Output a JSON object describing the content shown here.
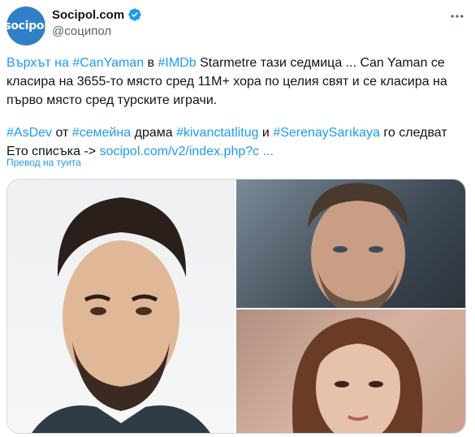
{
  "account": {
    "avatar_text": "socipol",
    "name": "Socipol.com",
    "handle": "@соципол",
    "verified": true
  },
  "tweet": {
    "line1": [
      {
        "text": "Върхът на ",
        "link": true
      },
      {
        "text": "#CanYaman",
        "link": true
      },
      {
        "text": " в ",
        "link": false
      },
      {
        "text": "#IMDb",
        "link": true
      },
      {
        "text": " Starmetre тази седмица ... Can Yaman се класира на 3655-то място сред 11М+ хора по целия свят и се класира на първо място сред турските играчи.",
        "link": false
      }
    ],
    "line2": [
      {
        "text": "#AsDev",
        "link": true
      },
      {
        "text": " от ",
        "link": false
      },
      {
        "text": "#семейна",
        "link": true
      },
      {
        "text": " драма ",
        "link": false
      },
      {
        "text": "#kivanctatlitug",
        "link": true
      },
      {
        "text": "  и ",
        "link": false
      },
      {
        "text": "#SerenaySarıkaya",
        "link": true
      },
      {
        "text": " го следват Ето списъка -> ",
        "link": false
      },
      {
        "text": "socipol.com/v2/index.php?c ...",
        "link": true
      }
    ],
    "translate_label": "Превод на туита"
  },
  "colors": {
    "link": "#1d9bf0",
    "avatar_bg": "#2f80c8",
    "muted": "#536471"
  },
  "media": {
    "images": [
      "man-with-beard-portrait",
      "man-portrait-outdoor",
      "woman-portrait"
    ]
  }
}
